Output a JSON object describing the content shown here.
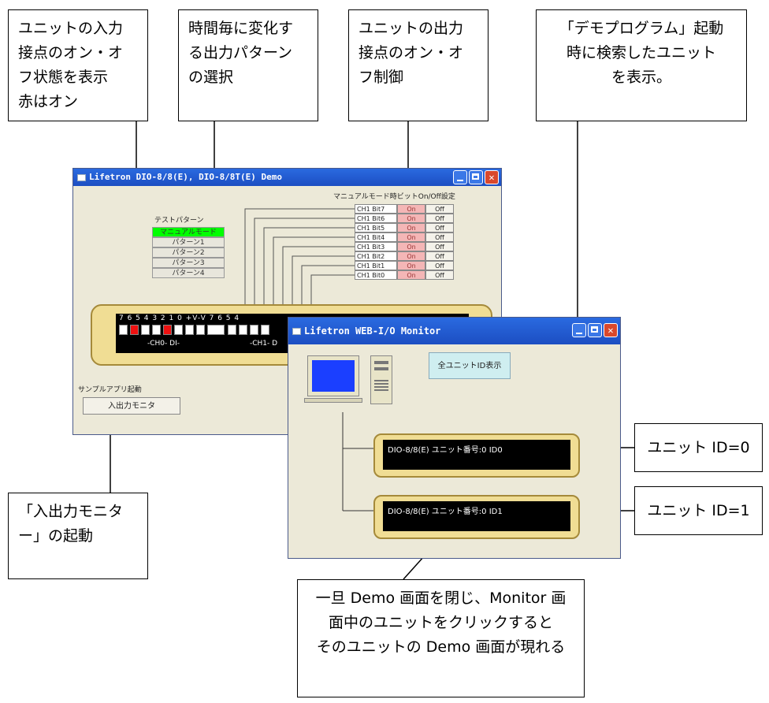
{
  "callouts": {
    "input_status": "ユニットの入力\n接点のオン・オ\nフ状態を表示\n赤はオン",
    "pattern_select": "時間毎に変化す\nる出力パターン\nの選択",
    "output_control": "ユニットの出力\n接点のオン・オ\nフ制御",
    "demo_units": "「デモプログラム」起動\n時に検索したユニット\nを表示。",
    "monitor_launch": "「入出力モニタ\nー」の起動",
    "unit_id0": "ユニット ID=0",
    "unit_id1": "ユニット ID=1",
    "bottom_note": "一旦 Demo 画面を閉じ、Monitor 画\n面中のユニットをクリックすると\nそのユニットの Demo 画面が現れる"
  },
  "demo_window": {
    "title": "Lifetron DIO-8/8(E), DIO-8/8T(E) Demo",
    "manual_header": "マニュアルモード時ビットOn/Off設定",
    "pattern_group_label": "テストパターン",
    "patterns": [
      "マニュアルモード",
      "パターン1",
      "パターン2",
      "パターン3",
      "パターン4"
    ],
    "bits": [
      {
        "label": "CH1 Bit7",
        "on": "On",
        "off": "Off"
      },
      {
        "label": "CH1 Bit6",
        "on": "On",
        "off": "Off"
      },
      {
        "label": "CH1 Bit5",
        "on": "On",
        "off": "Off"
      },
      {
        "label": "CH1 Bit4",
        "on": "On",
        "off": "Off"
      },
      {
        "label": "CH1 Bit3",
        "on": "On",
        "off": "Off"
      },
      {
        "label": "CH1 Bit2",
        "on": "On",
        "off": "Off"
      },
      {
        "label": "CH1 Bit1",
        "on": "On",
        "off": "Off"
      },
      {
        "label": "CH1 Bit0",
        "on": "On",
        "off": "Off"
      }
    ],
    "pin_labels": "7 6 5 4 3 2 1 0 +V-V 7 6 5 4",
    "ch0_label": "-CH0- DI-",
    "ch1_label": "-CH1- D",
    "sample_group_label": "サンプルアプリ起動",
    "monitor_button": "入出力モニタ"
  },
  "monitor_window": {
    "title": "Lifetron WEB-I/O Monitor",
    "show_all_button": "全ユニットID表示",
    "units": [
      {
        "text": "DIO-8/8(E)  ユニット番号:0  ID0"
      },
      {
        "text": "DIO-8/8(E)  ユニット番号:0  ID1"
      }
    ]
  }
}
